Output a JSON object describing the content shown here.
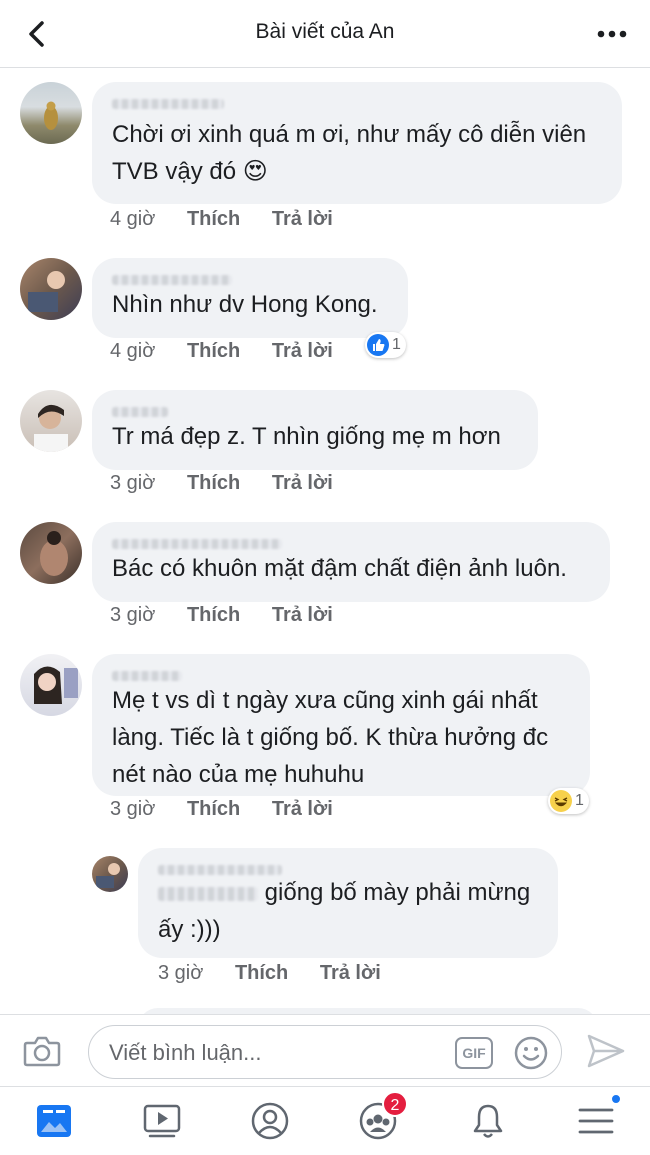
{
  "header": {
    "title": "Bài viết của An",
    "back_icon": "chevron-left-icon",
    "more_icon": "more-horizontal-icon"
  },
  "actions": {
    "like": "Thích",
    "reply": "Trả lời"
  },
  "comments": [
    {
      "text": "Chời ơi xinh quá m ơi, như mấy cô diễn viên TVB vậy đó 😍",
      "time": "4 giờ",
      "reaction": ""
    },
    {
      "text": "Nhìn như dv Hong Kong.",
      "time": "4 giờ",
      "reaction": {
        "icon": "like-icon",
        "count": "1"
      }
    },
    {
      "text": "Tr má đẹp z. T nhìn giống mẹ m hơn",
      "time": "3 giờ",
      "reaction": ""
    },
    {
      "text": "Bác có khuôn mặt đậm chất điện ảnh luôn.",
      "time": "3 giờ",
      "reaction": ""
    },
    {
      "text": "Mẹ t vs dì t ngày xưa cũng xinh gái nhất làng. Tiếc là t giống bố. K thừa hưởng đc nét nào của mẹ huhuhu",
      "time": "3 giờ",
      "reaction": {
        "icon": "haha-icon",
        "count": "1"
      }
    }
  ],
  "reply": {
    "text": "giống bố mày phải mừng ấy :)))",
    "time": "3 giờ"
  },
  "composer": {
    "placeholder": "Viết bình luận...",
    "gif_label": "GIF"
  },
  "tabbar": {
    "groups_badge": "2"
  },
  "colors": {
    "bubble": "#f0f2f5",
    "muted": "#65676b",
    "accent": "#1877f2",
    "badge": "#e41e3f"
  }
}
